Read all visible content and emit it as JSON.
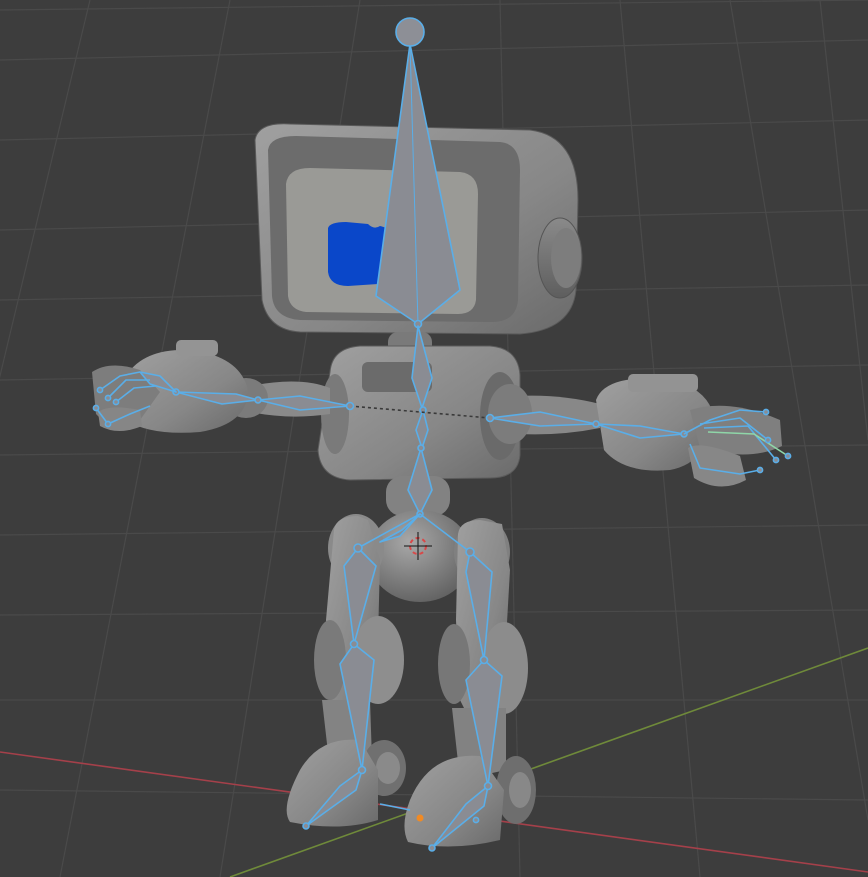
{
  "viewport": {
    "background": "#3d3d3d",
    "grid_color": "#4a4a4a",
    "x_axis_color": "#a5404a",
    "y_axis_color": "#6f8a3a"
  },
  "scene": {
    "model": "robot",
    "screen_accent_color": "#0a47c9",
    "body_color": "#8e8e8e",
    "armature_color": "#5aaee8",
    "bone_fill_color": "#8a8c93"
  },
  "icons": {
    "3d_cursor": "3d-cursor-icon",
    "origin": "origin-dot-icon"
  }
}
